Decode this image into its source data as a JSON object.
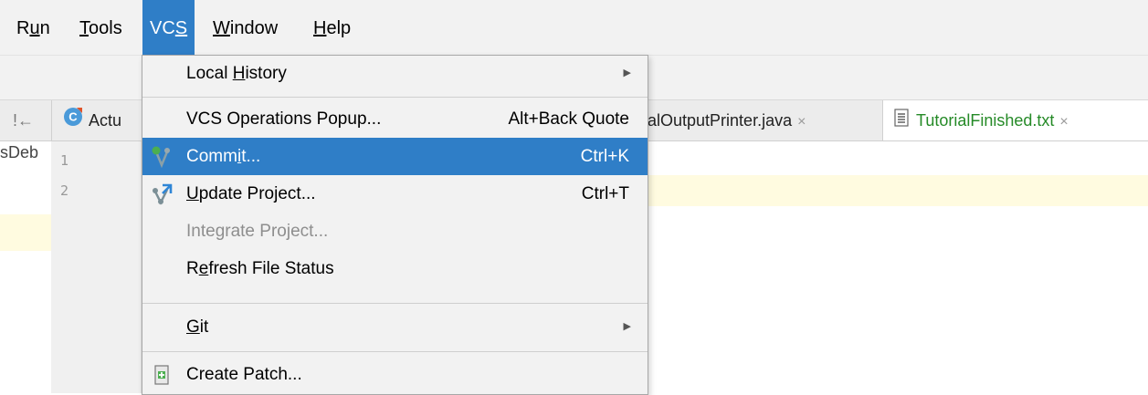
{
  "menubar": {
    "items": [
      {
        "pre": "R",
        "mnemonic": "u",
        "post": "n"
      },
      {
        "pre": "",
        "mnemonic": "T",
        "post": "ools"
      },
      {
        "pre": "VC",
        "mnemonic": "S",
        "post": ""
      },
      {
        "pre": "",
        "mnemonic": "W",
        "post": "indow"
      },
      {
        "pre": "",
        "mnemonic": "H",
        "post": "elp"
      }
    ],
    "active": "VCS"
  },
  "tabs": {
    "left_icon_text": "!←",
    "first_tab": {
      "icon_letter": "C",
      "label": "Actu"
    },
    "middle_tab": {
      "label": "alOutputPrinter.java",
      "close": "×"
    },
    "selected_tab": {
      "label": "TutorialFinished.txt",
      "close": "×"
    }
  },
  "editor": {
    "side_text": "sDeb",
    "line_numbers": [
      "1",
      "2"
    ]
  },
  "vcs_menu": {
    "items": [
      {
        "pre": "Local ",
        "mnemonic": "H",
        "post": "istory",
        "shortcut": "",
        "submenu": true,
        "state": "normal"
      },
      {
        "pre": "VCS Operations Popup...",
        "mnemonic": "",
        "post": "",
        "shortcut": "Alt+Back Quote",
        "submenu": false,
        "state": "normal"
      },
      {
        "pre": "Comm",
        "mnemonic": "i",
        "post": "t...",
        "shortcut": "Ctrl+K",
        "submenu": false,
        "state": "highlighted",
        "icon": "commit-icon"
      },
      {
        "pre": "",
        "mnemonic": "U",
        "post": "pdate Project...",
        "shortcut": "Ctrl+T",
        "submenu": false,
        "state": "normal",
        "icon": "update-project-icon"
      },
      {
        "pre": "Integrate Project...",
        "mnemonic": "",
        "post": "",
        "shortcut": "",
        "submenu": false,
        "state": "disabled"
      },
      {
        "pre": "R",
        "mnemonic": "e",
        "post": "fresh File Status",
        "shortcut": "",
        "submenu": false,
        "state": "normal"
      },
      {
        "pre": "",
        "mnemonic": "G",
        "post": "it",
        "shortcut": "",
        "submenu": true,
        "state": "normal"
      },
      {
        "pre": "Create Patch...",
        "mnemonic": "",
        "post": "",
        "shortcut": "",
        "submenu": false,
        "state": "normal",
        "icon": "create-patch-icon"
      }
    ]
  },
  "colors": {
    "highlight": "#2f7ec7",
    "selected_tab_text": "#258a27",
    "line_highlight": "#fffbe0",
    "disabled_text": "#8e8e8e"
  }
}
